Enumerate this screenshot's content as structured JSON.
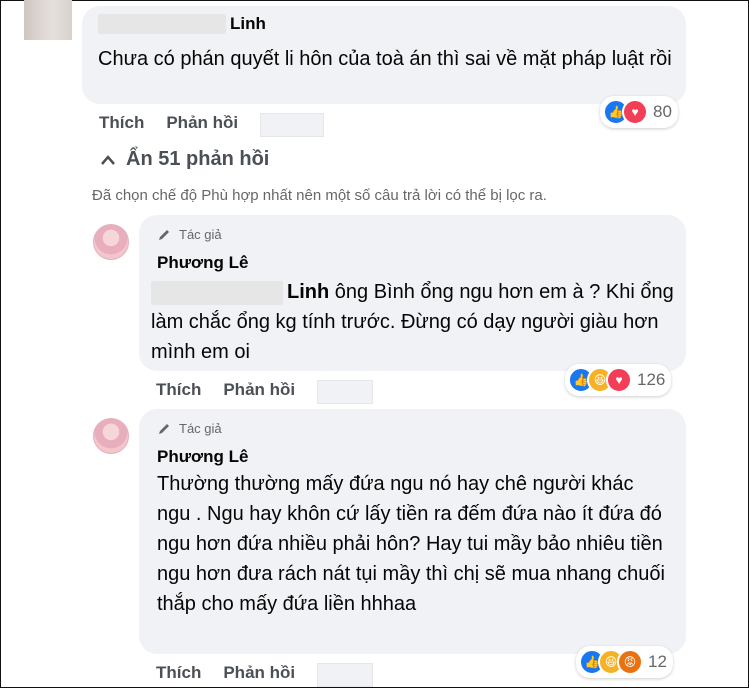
{
  "comment_top": {
    "author": "Linh",
    "text": "Chưa có phán quyết li hôn của toà án thì sai về mặt pháp luật rồi",
    "like_label": "Thích",
    "reply_label": "Phản hồi",
    "reactions": [
      "like",
      "love"
    ],
    "reaction_count": "80"
  },
  "thread": {
    "hide_replies_label": "Ẩn 51 phản hồi",
    "filter_notice": "Đã chọn chế độ Phù hợp nhất nên một số câu trả lời có thể bị lọc ra."
  },
  "replies": [
    {
      "badge": "Tác giả",
      "author": "Phương Lê",
      "mention": "Linh",
      "text": "ông Bình ổng ngu hơn em à ? Khi ổng làm chắc ổng kg tính trước. Đừng có dạy người giàu hơn mình em oi",
      "like_label": "Thích",
      "reply_label": "Phản hồi",
      "reactions": [
        "like",
        "haha",
        "love"
      ],
      "reaction_count": "126"
    },
    {
      "badge": "Tác giả",
      "author": "Phương Lê",
      "text": "Thường thường mấy đứa ngu nó hay chê người khác ngu . Ngu hay khôn cứ lấy tiền ra đếm đứa nào ít đứa đó ngu hơn đứa nhiều phải hôn? Hay tui mầy bảo nhiêu tiền ngu hơn đưa rách nát tụi mầy thì chị sẽ mua nhang chuối thắp cho mấy đứa liền hhhaa",
      "like_label": "Thích",
      "reply_label": "Phản hồi",
      "reactions": [
        "like",
        "haha",
        "angry"
      ],
      "reaction_count": "12"
    }
  ],
  "colors": {
    "like": "#1877f2",
    "love": "#f33e58",
    "haha": "#f7b125",
    "angry": "#e9710f",
    "bubble": "#f0f2f5"
  }
}
